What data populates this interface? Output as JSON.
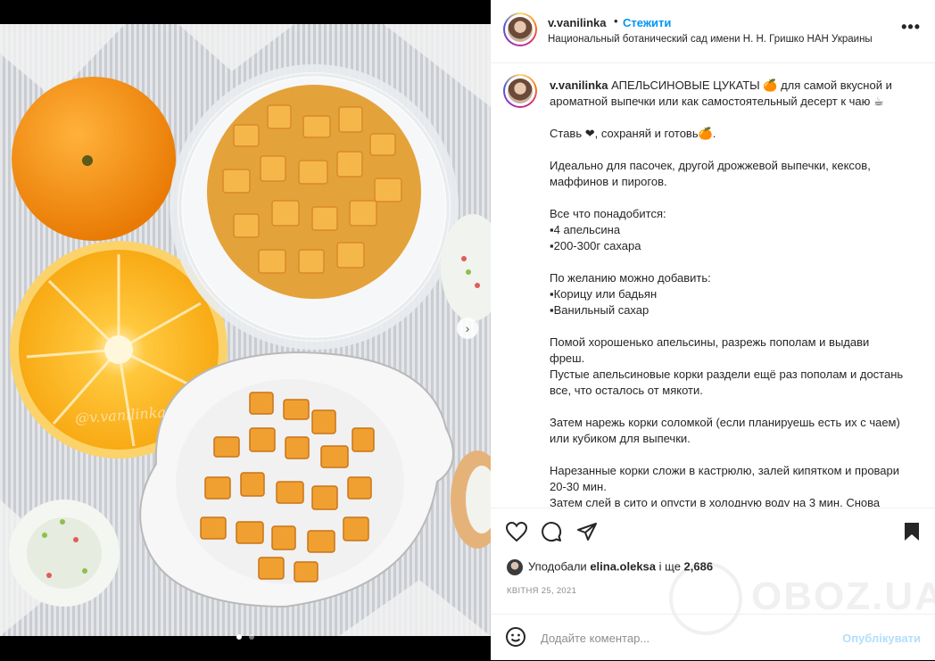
{
  "header": {
    "username": "v.vanilinka",
    "separator": "•",
    "follow_label": "Стежити",
    "location": "Национальный ботанический сад имени Н. Н. Гришко НАН Украины",
    "more_label": "•••"
  },
  "caption": {
    "username": "v.vanilinka",
    "text": " АПЕЛЬСИНОВЫЕ ЦУКАТЫ 🍊 для самой вкусной и ароматной выпечки или как самостоятельный десерт к чаю ☕\n\nСтавь ❤, сохраняй и готовь🍊.\n\nИдеально для пасочек, другой дрожжевой выпечки, кексов, маффинов и пирогов.\n\nВсе что понадобится:\n▪4 апельсина\n▪200-300г сахара\n\nПо желанию можно добавить:\n▪Корицу или бадьян\n▪Ванильный сахар\n\nПомой хорошенько апельсины, разрежь пополам и выдави фреш.\nПустые апельсиновые корки раздели ещё раз пополам и достань все, что осталось от мякоти.\n\nЗатем нарежь корки соломкой (если планируешь есть их с чаем) или кубиком для выпечки.\n\nНарезанные корки сложи в кастрюлю, залей кипятком и провари 20-30 мин.\nЗатем слей в сито и опусти в холодную воду на 3 мин. Снова"
  },
  "likes": {
    "prefix": "Уподобали ",
    "user": "elina.oleksa",
    "middle": " і ще ",
    "count": "2,686"
  },
  "date": "КВІТНЯ 25, 2021",
  "comment": {
    "placeholder": "Додайте коментар...",
    "publish_label": "Опублікувати"
  },
  "photo": {
    "watermark": "@v.vanilinka",
    "carousel_dots": 2,
    "active_dot": 0
  },
  "site_watermark": "OBOZ.UA",
  "colors": {
    "accent": "#0095f6",
    "publish_disabled": "#b2dffc",
    "orange": "#f4a21c"
  }
}
